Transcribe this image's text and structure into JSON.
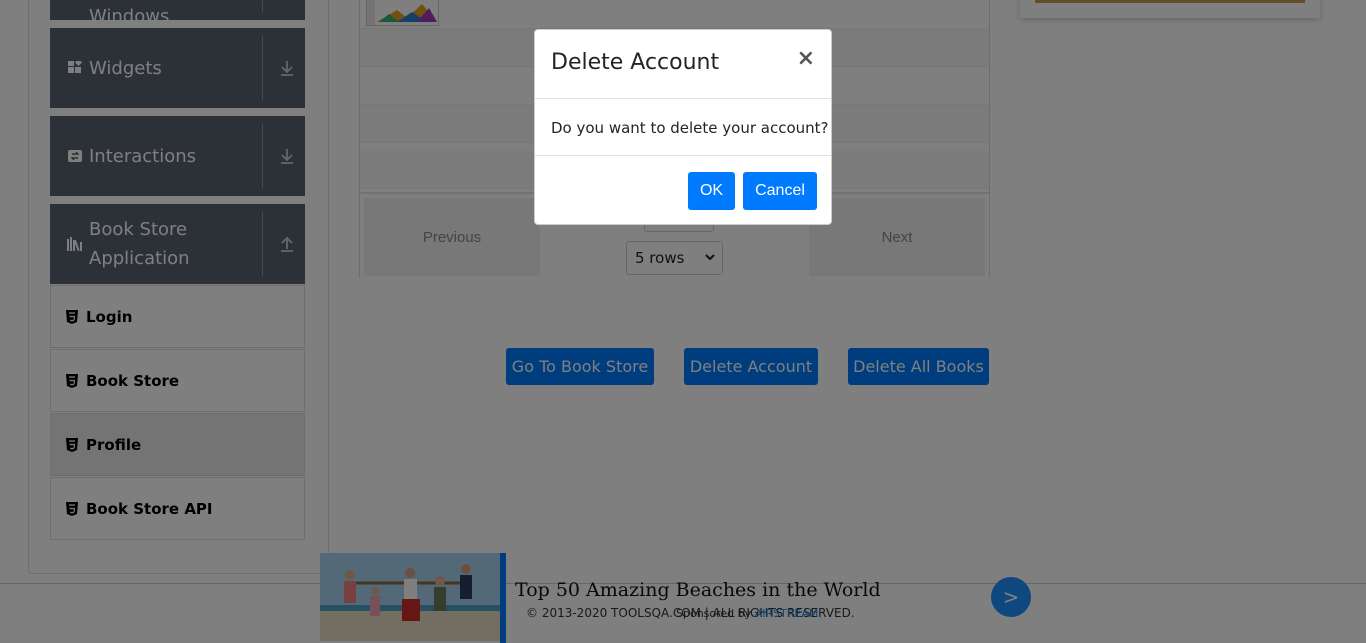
{
  "sidebar": {
    "partial_group_label": "Windows",
    "groups": [
      {
        "label": "Widgets",
        "icon": "widgets-icon",
        "arrow": "expand-arrow-icon"
      },
      {
        "label": "Interactions",
        "icon": "interactions-icon",
        "arrow": "expand-arrow-icon"
      },
      {
        "label": "Book Store\nApplication",
        "icon": "book-store-icon",
        "arrow": "collapse-arrow-icon"
      }
    ],
    "items": [
      {
        "label": "Login",
        "icon": "html5-icon"
      },
      {
        "label": "Book Store",
        "icon": "html5-icon"
      },
      {
        "label": "Profile",
        "icon": "html5-icon",
        "active": true
      },
      {
        "label": "Book Store API",
        "icon": "html5-icon"
      }
    ]
  },
  "table": {
    "previous_label": "Previous",
    "next_label": "Next",
    "rows_select_value": "5 rows"
  },
  "actions": {
    "go_to_store": "Go To Book Store",
    "delete_account": "Delete Account",
    "delete_all_books": "Delete All Books"
  },
  "footer": {
    "copyright": "© 2013-2020 TOOLSQA.COM | ALL RIGHTS RESERVED."
  },
  "ad": {
    "title": "Top 50 Amazing Beaches in the World",
    "sponsor_prefix": "Sponsored by",
    "sponsor_brand": "AIRSTREAM",
    "next_label": ">"
  },
  "modal": {
    "title": "Delete Account",
    "close_label": "×",
    "message": "Do you want to delete your account?",
    "ok_label": "OK",
    "cancel_label": "Cancel"
  },
  "colors": {
    "primary": "#007bff",
    "sidebar_group": "#58636f",
    "backdrop": "rgba(0,0,0,0.5)"
  }
}
